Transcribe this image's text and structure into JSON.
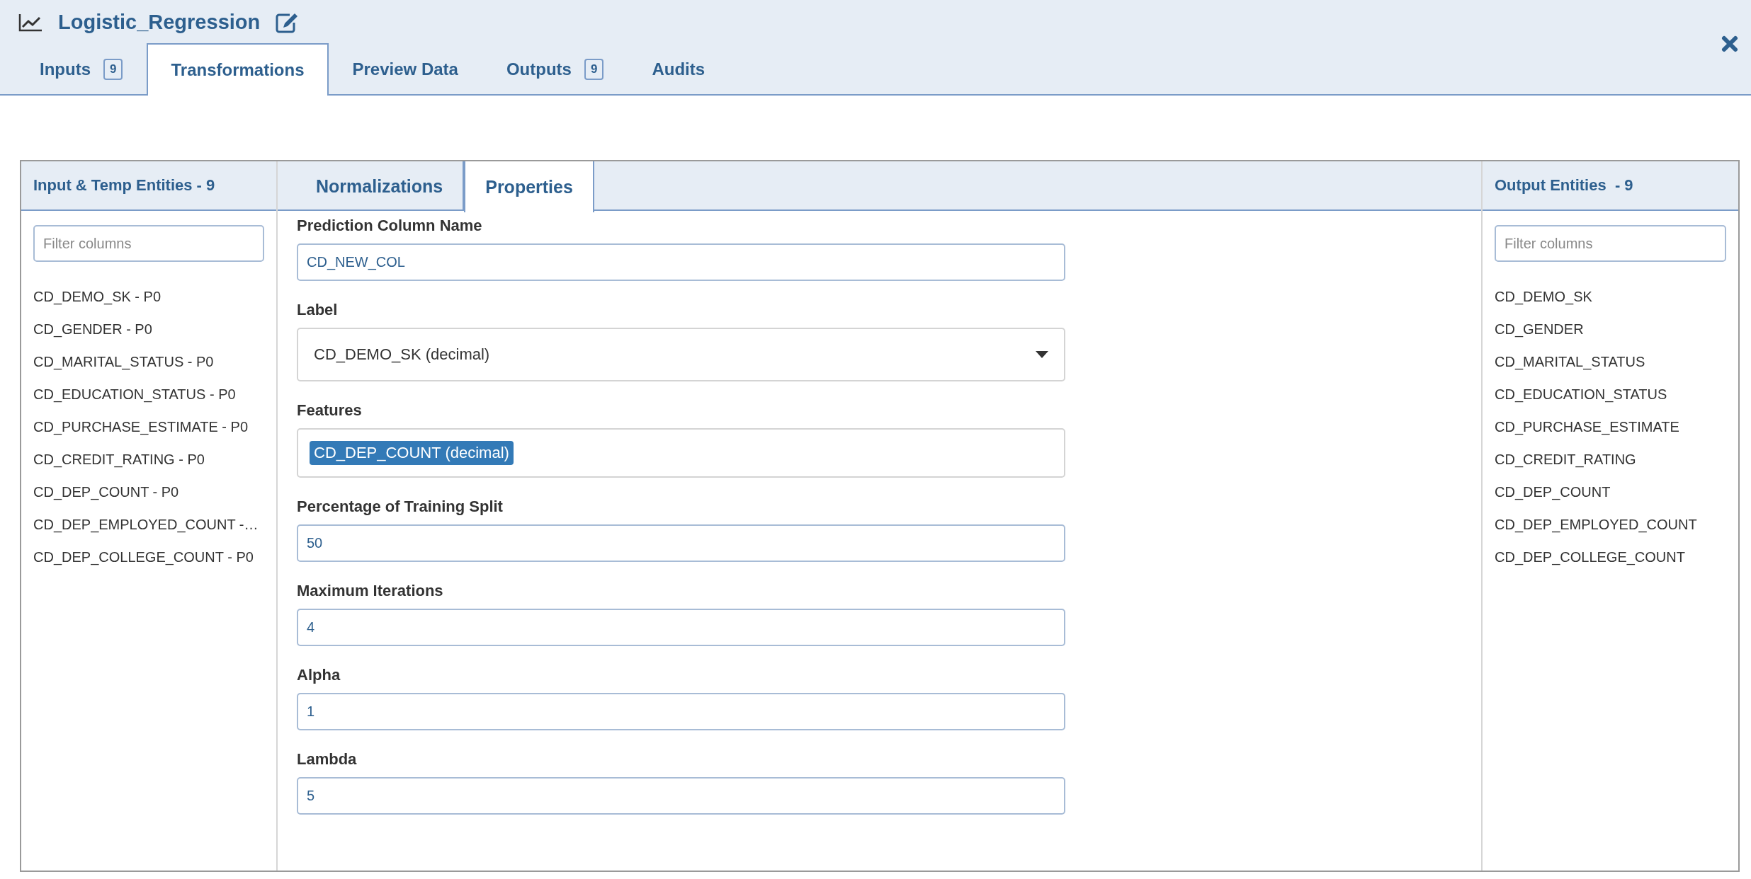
{
  "header": {
    "title": "Logistic_Regression"
  },
  "tabs": [
    {
      "label": "Inputs",
      "badge": "9",
      "selected": false
    },
    {
      "label": "Transformations",
      "selected": true
    },
    {
      "label": "Preview Data",
      "selected": false
    },
    {
      "label": "Outputs",
      "badge": "9",
      "selected": false
    },
    {
      "label": "Audits",
      "selected": false
    }
  ],
  "input_panel": {
    "title": "Input & Temp Entities - 9",
    "filter": {
      "placeholder": "Filter columns"
    },
    "columns": [
      "CD_DEMO_SK - P0",
      "CD_GENDER - P0",
      "CD_MARITAL_STATUS - P0",
      "CD_EDUCATION_STATUS - P0",
      "CD_PURCHASE_ESTIMATE - P0",
      "CD_CREDIT_RATING - P0",
      "CD_DEP_COUNT - P0",
      "CD_DEP_EMPLOYED_COUNT -…",
      "CD_DEP_COLLEGE_COUNT - P0"
    ]
  },
  "center_tabs": [
    {
      "label": "Normalizations",
      "selected": false
    },
    {
      "label": "Properties",
      "selected": true
    }
  ],
  "properties": [
    {
      "kind": "text",
      "label": "Prediction Column Name",
      "value": "CD_NEW_COL"
    },
    {
      "kind": "select",
      "label": "Label",
      "value": "CD_DEMO_SK (decimal)"
    },
    {
      "kind": "tags",
      "label": "Features",
      "tags": [
        "CD_DEP_COUNT (decimal)"
      ]
    },
    {
      "kind": "text",
      "label": "Percentage of Training Split",
      "value": "50"
    },
    {
      "kind": "text",
      "label": "Maximum Iterations",
      "value": "4"
    },
    {
      "kind": "text",
      "label": "Alpha",
      "value": "1"
    },
    {
      "kind": "text",
      "label": "Lambda",
      "value": "5"
    }
  ],
  "output_panel": {
    "title": "Output Entities  - 9",
    "filter": {
      "placeholder": "Filter columns"
    },
    "columns": [
      "CD_DEMO_SK",
      "CD_GENDER",
      "CD_MARITAL_STATUS",
      "CD_EDUCATION_STATUS",
      "CD_PURCHASE_ESTIMATE",
      "CD_CREDIT_RATING",
      "CD_DEP_COUNT",
      "CD_DEP_EMPLOYED_COUNT",
      "CD_DEP_COLLEGE_COUNT"
    ]
  }
}
